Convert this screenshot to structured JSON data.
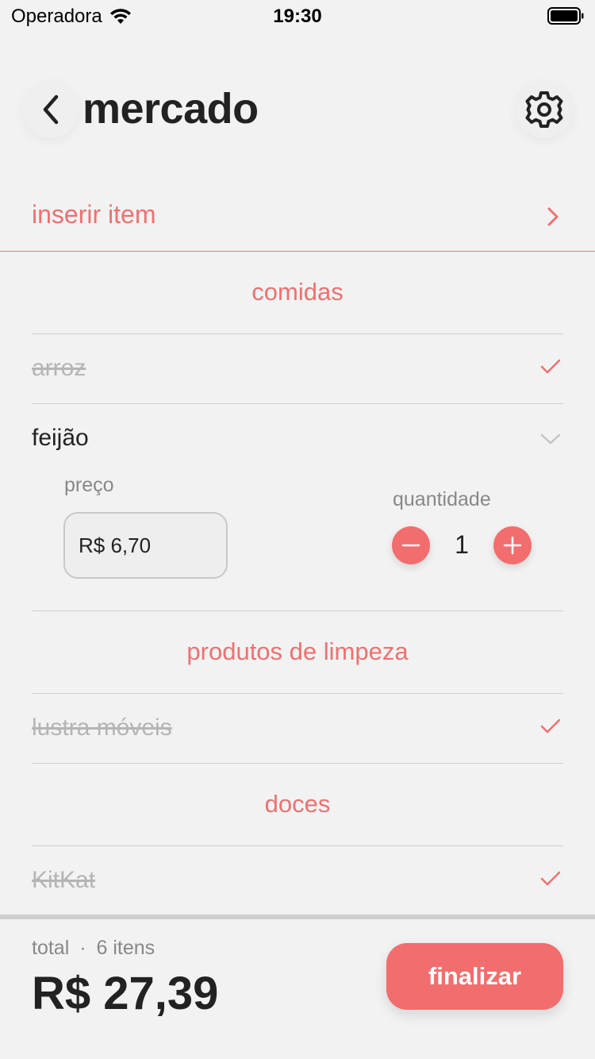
{
  "status_bar": {
    "carrier": "Operadora",
    "time": "19:30"
  },
  "header": {
    "title": "mercado"
  },
  "insert": {
    "label": "inserir item"
  },
  "sections": [
    {
      "title": "comidas"
    },
    {
      "title": "produtos de limpeza"
    },
    {
      "title": "doces"
    }
  ],
  "items": [
    {
      "name": "arroz",
      "checked": true
    },
    {
      "name": "feijão",
      "checked": false,
      "expanded": true
    },
    {
      "name": "lustra móveis",
      "checked": true
    },
    {
      "name": "KitKat",
      "checked": true
    }
  ],
  "detail": {
    "price_label": "preço",
    "price_value": "R$ 6,70",
    "quantity_label": "quantidade",
    "quantity_value": "1"
  },
  "footer": {
    "total_label": "total",
    "separator": "·",
    "items_count": "6 itens",
    "total_value": "R$ 27,39",
    "finish_label": "finalizar"
  },
  "colors": {
    "accent": "#f26d6d",
    "background": "#f2f2f2",
    "text": "#222222",
    "muted": "#888888"
  }
}
